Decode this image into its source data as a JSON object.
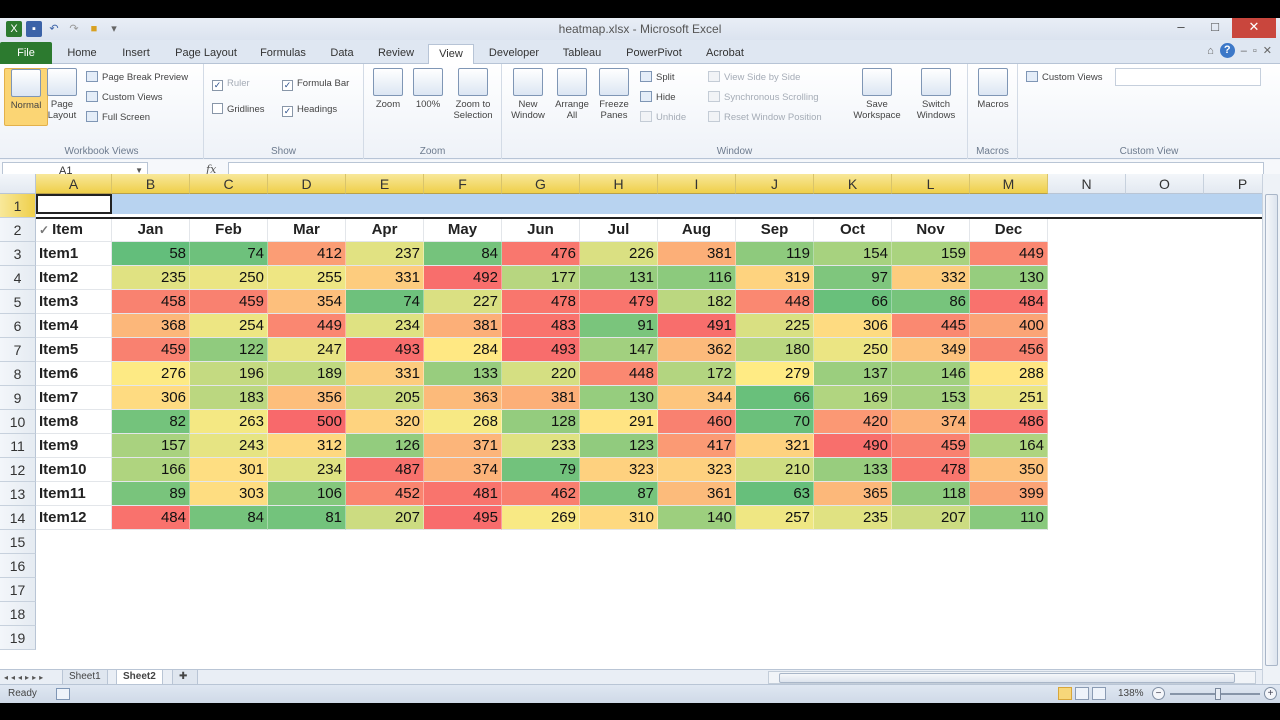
{
  "window": {
    "title": "heatmap.xlsx - Microsoft Excel"
  },
  "tabs": [
    "File",
    "Home",
    "Insert",
    "Page Layout",
    "Formulas",
    "Data",
    "Review",
    "View",
    "Developer",
    "Tableau",
    "PowerPivot",
    "Acrobat"
  ],
  "active_tab": "View",
  "ribbon": {
    "workbook_views": {
      "label": "Workbook Views",
      "normal": "Normal",
      "page_layout": "Page Layout",
      "page_break_preview": "Page Break Preview",
      "custom_views": "Custom Views",
      "full_screen": "Full Screen"
    },
    "show": {
      "label": "Show",
      "ruler": "Ruler",
      "formula_bar": "Formula Bar",
      "gridlines": "Gridlines",
      "headings": "Headings"
    },
    "zoom": {
      "label": "Zoom",
      "zoom": "Zoom",
      "hundred": "100%",
      "zoom_to_selection": "Zoom to Selection"
    },
    "window": {
      "label": "Window",
      "new_window": "New Window",
      "arrange_all": "Arrange All",
      "freeze_panes": "Freeze Panes",
      "split": "Split",
      "hide": "Hide",
      "unhide": "Unhide",
      "view_side_by_side": "View Side by Side",
      "synchronous_scrolling": "Synchronous Scrolling",
      "reset_window_position": "Reset Window Position",
      "save_workspace": "Save Workspace",
      "switch_windows": "Switch Windows"
    },
    "macros": {
      "label": "Macros",
      "macros": "Macros"
    },
    "custom_view": {
      "label": "Custom View",
      "custom_views": "Custom Views"
    }
  },
  "formula_bar": {
    "name_box": "A1",
    "fx": "fx",
    "formula": ""
  },
  "grid": {
    "columns": [
      "A",
      "B",
      "C",
      "D",
      "E",
      "F",
      "G",
      "H",
      "I",
      "J",
      "K",
      "L",
      "M",
      "N",
      "O",
      "P"
    ],
    "row_numbers": [
      "1",
      "2",
      "3",
      "4",
      "5",
      "6",
      "7",
      "8",
      "9",
      "10",
      "11",
      "12",
      "13",
      "14",
      "15",
      "16",
      "17",
      "18",
      "19"
    ],
    "header_label": "Item",
    "months": [
      "Jan",
      "Feb",
      "Mar",
      "Apr",
      "May",
      "Jun",
      "Jul",
      "Aug",
      "Sep",
      "Oct",
      "Nov",
      "Dec"
    ],
    "rows": [
      {
        "label": "Item1",
        "values": [
          58,
          74,
          412,
          237,
          84,
          476,
          226,
          381,
          119,
          154,
          159,
          449
        ]
      },
      {
        "label": "Item2",
        "values": [
          235,
          250,
          255,
          331,
          492,
          177,
          131,
          116,
          319,
          97,
          332,
          130
        ]
      },
      {
        "label": "Item3",
        "values": [
          458,
          459,
          354,
          74,
          227,
          478,
          479,
          182,
          448,
          66,
          86,
          484
        ]
      },
      {
        "label": "Item4",
        "values": [
          368,
          254,
          449,
          234,
          381,
          483,
          91,
          491,
          225,
          306,
          445,
          400
        ]
      },
      {
        "label": "Item5",
        "values": [
          459,
          122,
          247,
          493,
          284,
          493,
          147,
          362,
          180,
          250,
          349,
          456
        ]
      },
      {
        "label": "Item6",
        "values": [
          276,
          196,
          189,
          331,
          133,
          220,
          448,
          172,
          279,
          137,
          146,
          288
        ]
      },
      {
        "label": "Item7",
        "values": [
          306,
          183,
          356,
          205,
          363,
          381,
          130,
          344,
          66,
          169,
          153,
          251
        ]
      },
      {
        "label": "Item8",
        "values": [
          82,
          263,
          500,
          320,
          268,
          128,
          291,
          460,
          70,
          420,
          374,
          486
        ]
      },
      {
        "label": "Item9",
        "values": [
          157,
          243,
          312,
          126,
          371,
          233,
          123,
          417,
          321,
          490,
          459,
          164
        ]
      },
      {
        "label": "Item10",
        "values": [
          166,
          301,
          234,
          487,
          374,
          79,
          323,
          323,
          210,
          133,
          478,
          350
        ]
      },
      {
        "label": "Item11",
        "values": [
          89,
          303,
          106,
          452,
          481,
          462,
          87,
          361,
          63,
          365,
          118,
          399
        ]
      },
      {
        "label": "Item12",
        "values": [
          484,
          84,
          81,
          207,
          495,
          269,
          310,
          140,
          257,
          235,
          207,
          110
        ]
      }
    ],
    "scale": {
      "min": 58,
      "max": 500,
      "low_color": "#63be7b",
      "mid_color": "#ffeb84",
      "high_color": "#f8696b"
    }
  },
  "sheets": [
    "Sheet1",
    "Sheet2"
  ],
  "active_sheet": "Sheet2",
  "status": {
    "ready": "Ready",
    "zoom": "138%"
  }
}
